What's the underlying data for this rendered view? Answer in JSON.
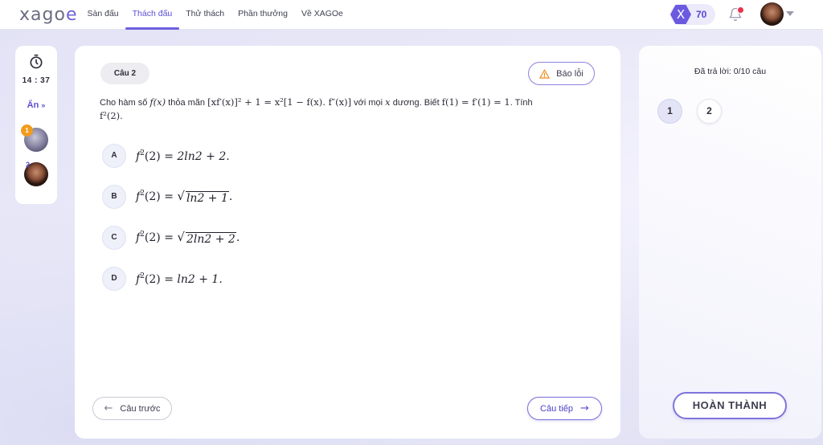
{
  "header": {
    "logo_text": "xago",
    "logo_accent": "e",
    "nav": [
      {
        "label": "Sàn đấu",
        "active": false
      },
      {
        "label": "Thách đấu",
        "active": true
      },
      {
        "label": "Thử thách",
        "active": false
      },
      {
        "label": "Phần thưởng",
        "active": false
      },
      {
        "label": "Về XAGOe",
        "active": false
      }
    ],
    "xp_icon": "X",
    "xp_value": "70",
    "notification_count": "1"
  },
  "sidebar": {
    "timer": "14 : 37",
    "hide_label": "Ẩn",
    "players": [
      {
        "rank": "1"
      },
      {
        "rank": "2"
      }
    ]
  },
  "question": {
    "label": "Câu 2",
    "report_label": "Báo lỗi",
    "prefix": "Cho hàm số",
    "fx": "f(x)",
    "mid1": "thỏa mãn",
    "equation": "[xf′(x)]² + 1 = x²[1 − f(x). f″(x)]",
    "mid2": "với mọi",
    "var": "x",
    "mid3": "dương. Biết",
    "given": "f(1) = f′(1) = 1",
    "suffix": ". Tính",
    "target": "f²(2).",
    "options": [
      {
        "letter": "A",
        "lhs": "f",
        "exp": "2",
        "arg": "(2) = ",
        "rhs": "2ln2 + 2.",
        "sqrt": false
      },
      {
        "letter": "B",
        "lhs": "f",
        "exp": "2",
        "arg": "(2) = ",
        "rhs": "ln2 + 1",
        "tail": ".",
        "sqrt": true
      },
      {
        "letter": "C",
        "lhs": "f",
        "exp": "2",
        "arg": "(2) = ",
        "rhs": "2ln2 + 2",
        "tail": ".",
        "sqrt": true
      },
      {
        "letter": "D",
        "lhs": "f",
        "exp": "2",
        "arg": "(2) = ",
        "rhs": "ln2 + 1.",
        "sqrt": false
      }
    ],
    "prev_label": "Câu trước",
    "next_label": "Câu tiếp"
  },
  "progress": {
    "answered_text": "Đã trả lời: 0/10 câu",
    "questions": [
      "1",
      "2"
    ],
    "finish_label": "HOÀN THÀNH"
  },
  "colors": {
    "accent": "#6c5fe0",
    "background": "#e6e7f7"
  }
}
